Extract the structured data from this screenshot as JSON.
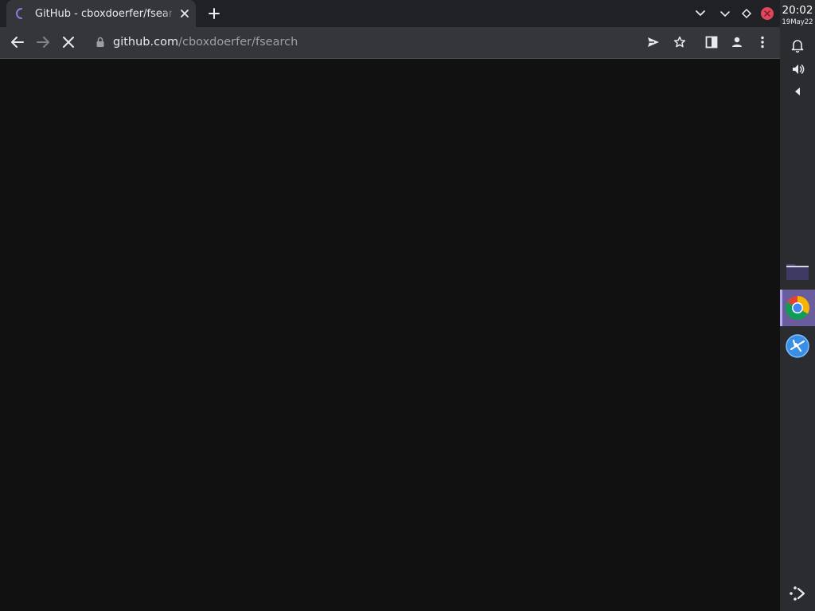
{
  "browser": {
    "tab": {
      "title": "GitHub - cboxdoerfer/fsearch",
      "close_icon": "close-icon",
      "loading_icon": "spinner-icon"
    },
    "new_tab_icon": "plus-icon",
    "tab_search_icon": "chevron-down-icon",
    "toolbar": {
      "back_icon": "arrow-left-icon",
      "forward_icon": "arrow-right-icon",
      "stop_icon": "close-icon",
      "url_host": "github.com",
      "url_path": "/cboxdoerfer/fsearch",
      "send_icon": "send-icon",
      "bookmark_icon": "star-icon",
      "side_panel_icon": "side-panel-icon",
      "profile_icon": "person-icon",
      "menu_icon": "kebab-menu-icon"
    }
  },
  "system": {
    "time": "20:02",
    "date": "19May22",
    "tray": [
      "chevron-down-icon",
      "diamond-icon",
      "close-circle-icon"
    ],
    "panel_icons": [
      "bell-icon",
      "volume-icon",
      "triangle-left-icon"
    ],
    "dock": [
      {
        "name": "files",
        "icon": "folder-icon",
        "active": false
      },
      {
        "name": "chrome",
        "icon": "chrome-icon",
        "active": true
      },
      {
        "name": "app",
        "icon": "airplane-app-icon",
        "active": false
      }
    ],
    "launcher_icon": "launcher-icon",
    "colors": {
      "accent": "#6a5d9e",
      "close_red": "#e0465c",
      "panel": "#2b2c30"
    }
  }
}
